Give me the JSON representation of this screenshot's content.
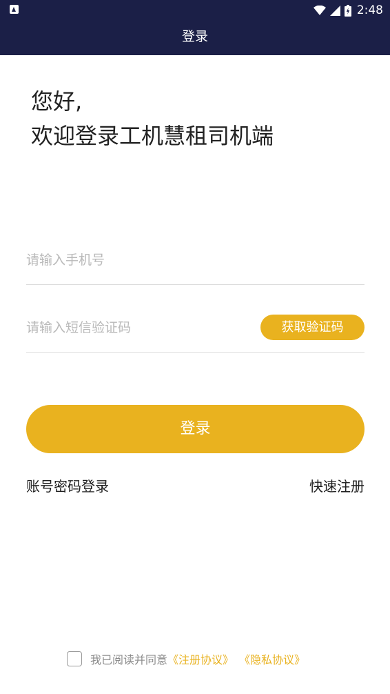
{
  "status_bar": {
    "time": "2:48",
    "icons": [
      "app-notification-icon",
      "wifi-icon",
      "signal-icon",
      "battery-icon"
    ]
  },
  "header": {
    "title": "登录"
  },
  "greeting": {
    "line1": "您好,",
    "line2": "欢迎登录工机慧租司机端"
  },
  "form": {
    "phone_placeholder": "请输入手机号",
    "code_placeholder": "请输入短信验证码",
    "get_code_label": "获取验证码",
    "login_label": "登录"
  },
  "links": {
    "password_login": "账号密码登录",
    "quick_register": "快速注册"
  },
  "agreement": {
    "text": "我已阅读并同意",
    "register_link": "《注册协议》",
    "privacy_link": "《隐私协议》",
    "checked": false
  },
  "colors": {
    "header_bg": "#1b1f47",
    "accent": "#e9b21f",
    "placeholder": "#b9b9b9",
    "divider": "#dcdcdc"
  }
}
